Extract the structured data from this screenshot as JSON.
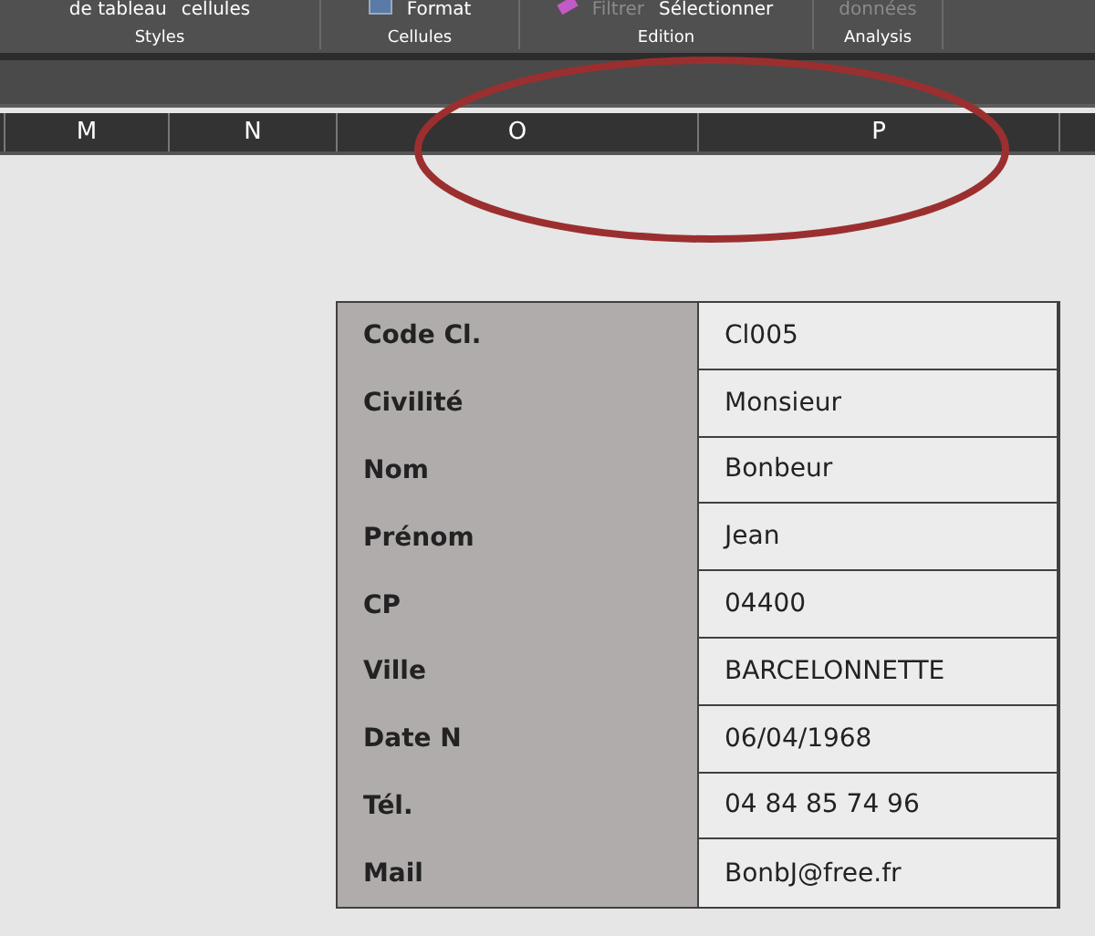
{
  "ribbon": {
    "groups": [
      {
        "label": "Styles",
        "items": [
          {
            "text": "de tableau",
            "disabled": false
          },
          {
            "text": "cellules",
            "disabled": false
          }
        ]
      },
      {
        "label": "Cellules",
        "items": [
          {
            "text": "Format",
            "disabled": false
          }
        ]
      },
      {
        "label": "Edition",
        "items": [
          {
            "text": "Filtrer",
            "disabled": true
          },
          {
            "text": "Sélectionner",
            "disabled": false
          }
        ]
      },
      {
        "label": "Analysis",
        "items": [
          {
            "text": "données",
            "disabled": true
          }
        ]
      }
    ]
  },
  "columns": [
    "M",
    "N",
    "O",
    "P"
  ],
  "record": [
    {
      "field": "Code Cl.",
      "value": "Cl005"
    },
    {
      "field": "Civilité",
      "value": "Monsieur"
    },
    {
      "field": "Nom",
      "value": "Bonbeur"
    },
    {
      "field": "Prénom",
      "value": "Jean"
    },
    {
      "field": "CP",
      "value": "04400"
    },
    {
      "field": "Ville",
      "value": "BARCELONNETTE"
    },
    {
      "field": "Date N",
      "value": "06/04/1968"
    },
    {
      "field": "Tél.",
      "value": "04 84 85 74 96"
    },
    {
      "field": "Mail",
      "value": "BonbJ@free.fr"
    }
  ]
}
